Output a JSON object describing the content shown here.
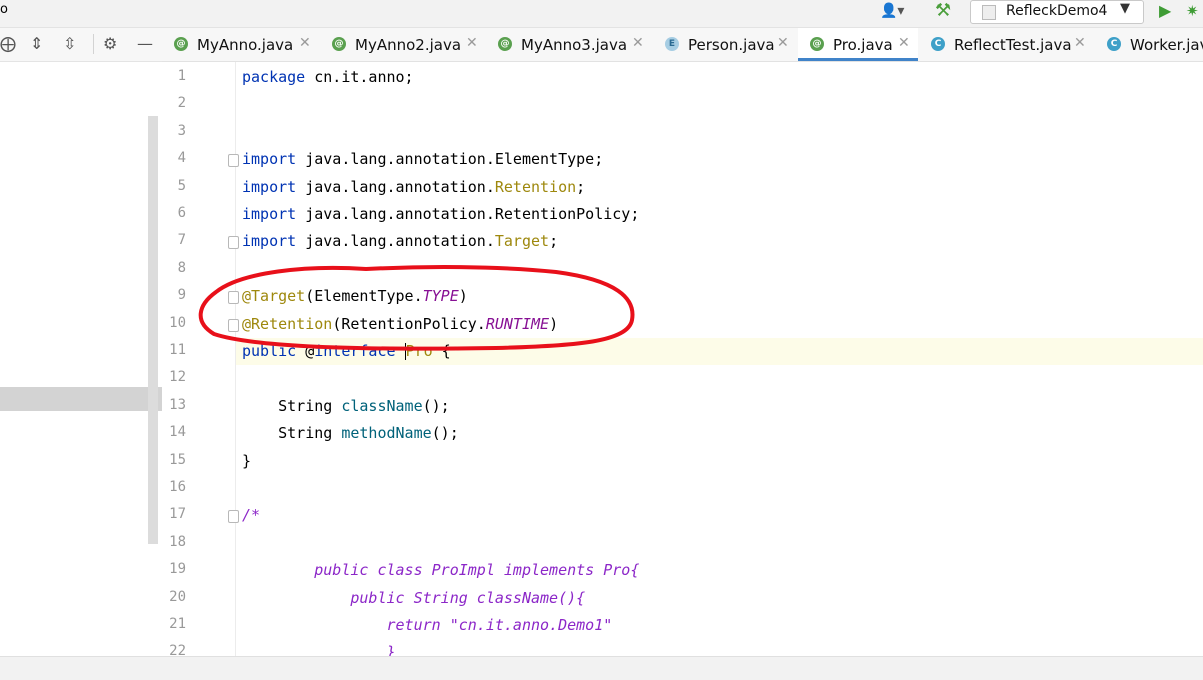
{
  "window": {
    "title_fragment": "o",
    "run_config": "RefleckDemo4",
    "user_icon": "user-icon",
    "build_icon": "hammer-icon",
    "run_icon": "run-icon",
    "debug_icon": "debug-icon"
  },
  "toolwindow": {
    "icons": [
      "locate-icon",
      "expand-all-icon",
      "collapse-all-icon",
      "gear-icon",
      "minimize-icon"
    ]
  },
  "tabs": [
    {
      "label": "MyAnno.java",
      "kind": "annotation",
      "active": false
    },
    {
      "label": "MyAnno2.java",
      "kind": "annotation",
      "active": false
    },
    {
      "label": "MyAnno3.java",
      "kind": "annotation",
      "active": false
    },
    {
      "label": "Person.java",
      "kind": "enum",
      "active": false
    },
    {
      "label": "Pro.java",
      "kind": "annotation",
      "active": true
    },
    {
      "label": "ReflectTest.java",
      "kind": "class",
      "active": false
    },
    {
      "label": "Worker.java",
      "kind": "class",
      "active": false
    }
  ],
  "editor": {
    "line_numbers": [
      "1",
      "2",
      "3",
      "4",
      "5",
      "6",
      "7",
      "8",
      "9",
      "10",
      "11",
      "12",
      "13",
      "14",
      "15",
      "16",
      "17",
      "18",
      "19",
      "20",
      "21",
      "22"
    ],
    "current_line": 11,
    "lines": [
      [
        {
          "t": "package",
          "c": "kw"
        },
        {
          "t": " cn.it.anno;"
        }
      ],
      [],
      [],
      [
        {
          "t": "import",
          "c": "kw"
        },
        {
          "t": " java.lang.annotation.ElementType;"
        }
      ],
      [
        {
          "t": "import",
          "c": "kw"
        },
        {
          "t": " java.lang.annotation."
        },
        {
          "t": "Retention",
          "c": "ann"
        },
        {
          "t": ";"
        }
      ],
      [
        {
          "t": "import",
          "c": "kw"
        },
        {
          "t": " java.lang.annotation.RetentionPolicy;"
        }
      ],
      [
        {
          "t": "import",
          "c": "kw"
        },
        {
          "t": " java.lang.annotation."
        },
        {
          "t": "Target",
          "c": "ann"
        },
        {
          "t": ";"
        }
      ],
      [],
      [
        {
          "t": "@Target",
          "c": "ann"
        },
        {
          "t": "(ElementType."
        },
        {
          "t": "TYPE",
          "c": "it"
        },
        {
          "t": ")"
        }
      ],
      [
        {
          "t": "@Retention",
          "c": "ann"
        },
        {
          "t": "(RetentionPolicy."
        },
        {
          "t": "RUNTIME",
          "c": "it"
        },
        {
          "t": ")"
        }
      ],
      [
        {
          "t": "public",
          "c": "kw"
        },
        {
          "t": " @"
        },
        {
          "t": "interface",
          "c": "kw"
        },
        {
          "t": " "
        },
        {
          "t": "|",
          "c": "caret"
        },
        {
          "t": "Pro",
          "c": "ann"
        },
        {
          "t": " {"
        }
      ],
      [],
      [
        {
          "t": "    String "
        },
        {
          "t": "className",
          "c": "mt"
        },
        {
          "t": "();"
        }
      ],
      [
        {
          "t": "    String "
        },
        {
          "t": "methodName",
          "c": "mt"
        },
        {
          "t": "();"
        }
      ],
      [
        {
          "t": "}"
        }
      ],
      [],
      [
        {
          "t": "/*",
          "c": "cm"
        }
      ],
      [],
      [
        {
          "t": "        public class ProImpl implements Pro{",
          "c": "cm"
        }
      ],
      [
        {
          "t": "            public String className(){",
          "c": "cm"
        }
      ],
      [
        {
          "t": "                return \"cn.it.anno.Demo1\"",
          "c": "cm"
        }
      ],
      [
        {
          "t": "                }",
          "c": "cm"
        }
      ]
    ],
    "fold_lines": [
      4,
      7,
      9,
      10,
      17
    ]
  }
}
